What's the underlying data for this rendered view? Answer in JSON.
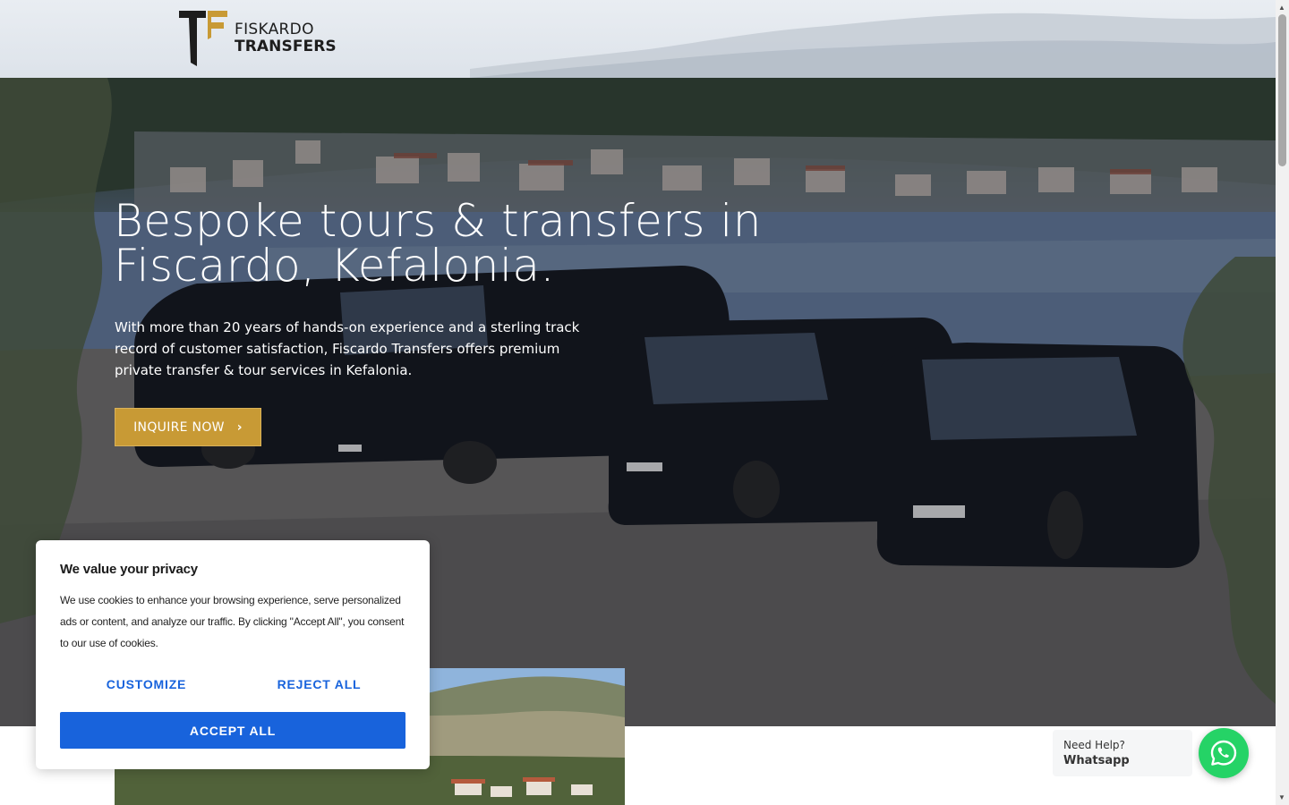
{
  "brand": {
    "name_line1": "FISKARDO",
    "name_line2": "TRANSFERS",
    "gold": "#c89a35",
    "dark": "#1d1d1d"
  },
  "hero": {
    "title_line1": "Bespoke tours & transfers in",
    "title_line2": "Fiscardo, Kefalonia.",
    "subtitle": "With more than 20 years of hands-on experience and a sterling track record of customer satisfaction, Fiscardo Transfers offers premium private transfer & tour services in Kefalonia.",
    "cta_label": "INQUIRE NOW",
    "cta_icon": "chevron-right-icon"
  },
  "cookie_banner": {
    "title": "We value your privacy",
    "text": "We use cookies to enhance your browsing experience, serve personalized ads or content, and analyze our traffic. By clicking \"Accept All\", you consent to our use of cookies.",
    "customize_label": "CUSTOMIZE",
    "reject_label": "REJECT ALL",
    "accept_label": "ACCEPT ALL",
    "accent": "#1863dc"
  },
  "whatsapp": {
    "need_help": "Need Help?",
    "label": "Whatsapp",
    "icon": "whatsapp-icon",
    "color": "#25d366"
  }
}
